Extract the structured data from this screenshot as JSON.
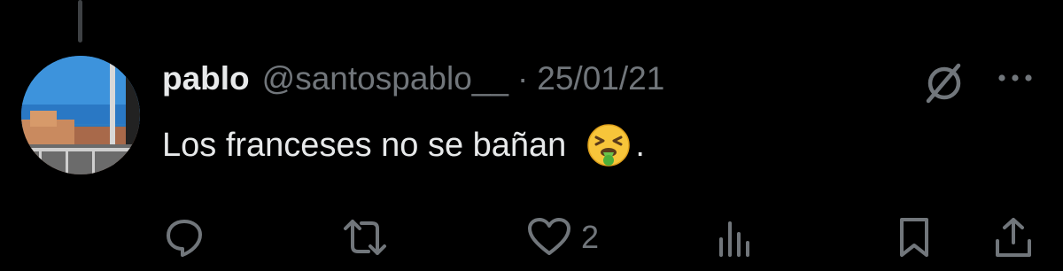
{
  "tweet": {
    "author_name": "pablo",
    "author_handle": "@santospablo__",
    "separator": "·",
    "date": "25/01/21",
    "text": "Los franceses no se bañan",
    "text_suffix": ".",
    "emoji": "nauseated-face"
  },
  "header_icons": {
    "grok": "no-entry-circle-slash-icon",
    "more": "more-dots-icon"
  },
  "actions": {
    "reply": {
      "icon": "reply-bubble-icon"
    },
    "retweet": {
      "icon": "retweet-icon"
    },
    "like": {
      "icon": "heart-icon",
      "count": "2"
    },
    "views": {
      "icon": "views-bars-icon"
    },
    "bookmark": {
      "icon": "bookmark-icon"
    },
    "share": {
      "icon": "share-icon"
    }
  },
  "colors": {
    "background": "#000000",
    "text_primary": "#e7e9ea",
    "text_secondary": "#71767b",
    "thread_line": "#3e4144"
  }
}
